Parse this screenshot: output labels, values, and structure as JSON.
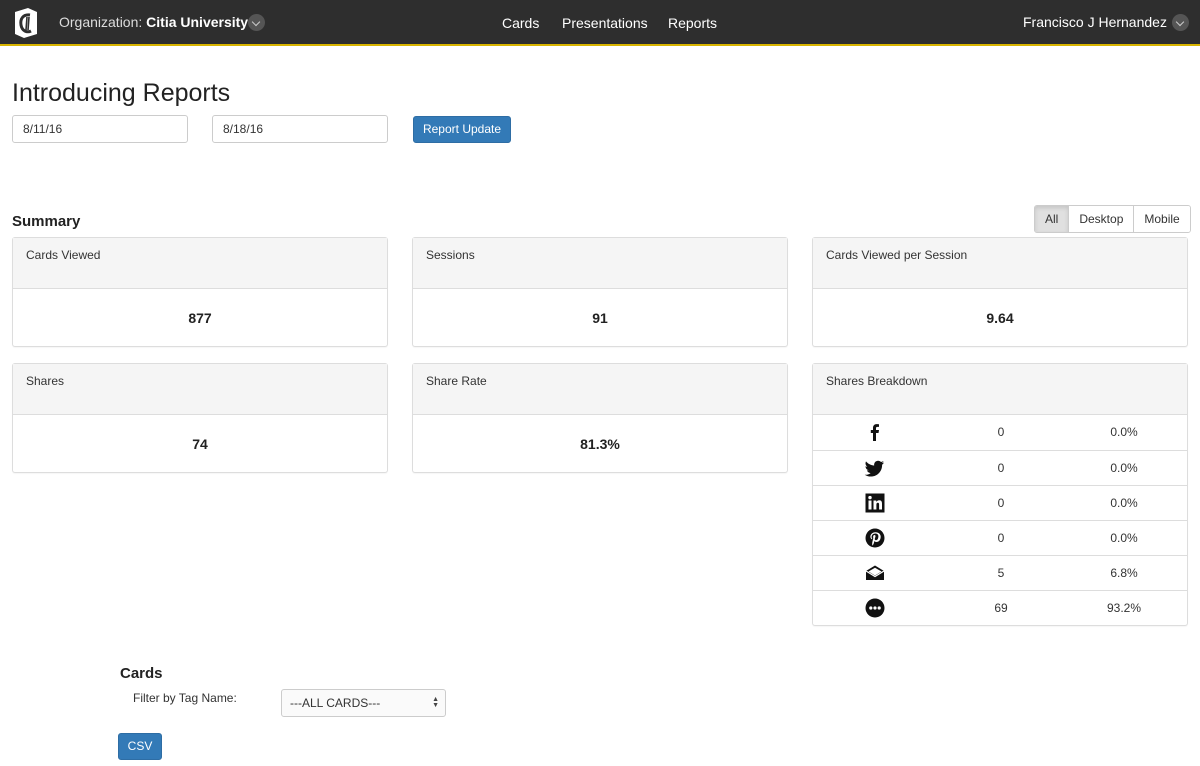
{
  "navbar": {
    "org_label": "Organization:",
    "org_name": "Citia University",
    "links": [
      "Cards",
      "Presentations",
      "Reports"
    ],
    "user": "Francisco J Hernandez"
  },
  "page": {
    "title": "Introducing Reports",
    "start_date": "8/11/16",
    "end_date": "8/18/16",
    "update_button": "Report Update"
  },
  "summary": {
    "title": "Summary",
    "filters": [
      "All",
      "Desktop",
      "Mobile"
    ],
    "selected_filter": "All",
    "panels": [
      {
        "label": "Cards Viewed",
        "value": "877"
      },
      {
        "label": "Sessions",
        "value": "91"
      },
      {
        "label": "Cards Viewed per Session",
        "value": "9.64"
      },
      {
        "label": "Shares",
        "value": "74"
      },
      {
        "label": "Share Rate",
        "value": "81.3%"
      }
    ],
    "breakdown": {
      "title": "Shares Breakdown",
      "rows": [
        {
          "icon": "facebook-icon",
          "count": "0",
          "percent": "0.0%"
        },
        {
          "icon": "twitter-icon",
          "count": "0",
          "percent": "0.0%"
        },
        {
          "icon": "linkedin-icon",
          "count": "0",
          "percent": "0.0%"
        },
        {
          "icon": "pinterest-icon",
          "count": "0",
          "percent": "0.0%"
        },
        {
          "icon": "email-icon",
          "count": "5",
          "percent": "6.8%"
        },
        {
          "icon": "more-icon",
          "count": "69",
          "percent": "93.2%"
        }
      ]
    }
  },
  "cards": {
    "title": "Cards",
    "filter_label": "Filter by Tag Name:",
    "filter_value": "---ALL CARDS---",
    "csv_button": "CSV"
  }
}
